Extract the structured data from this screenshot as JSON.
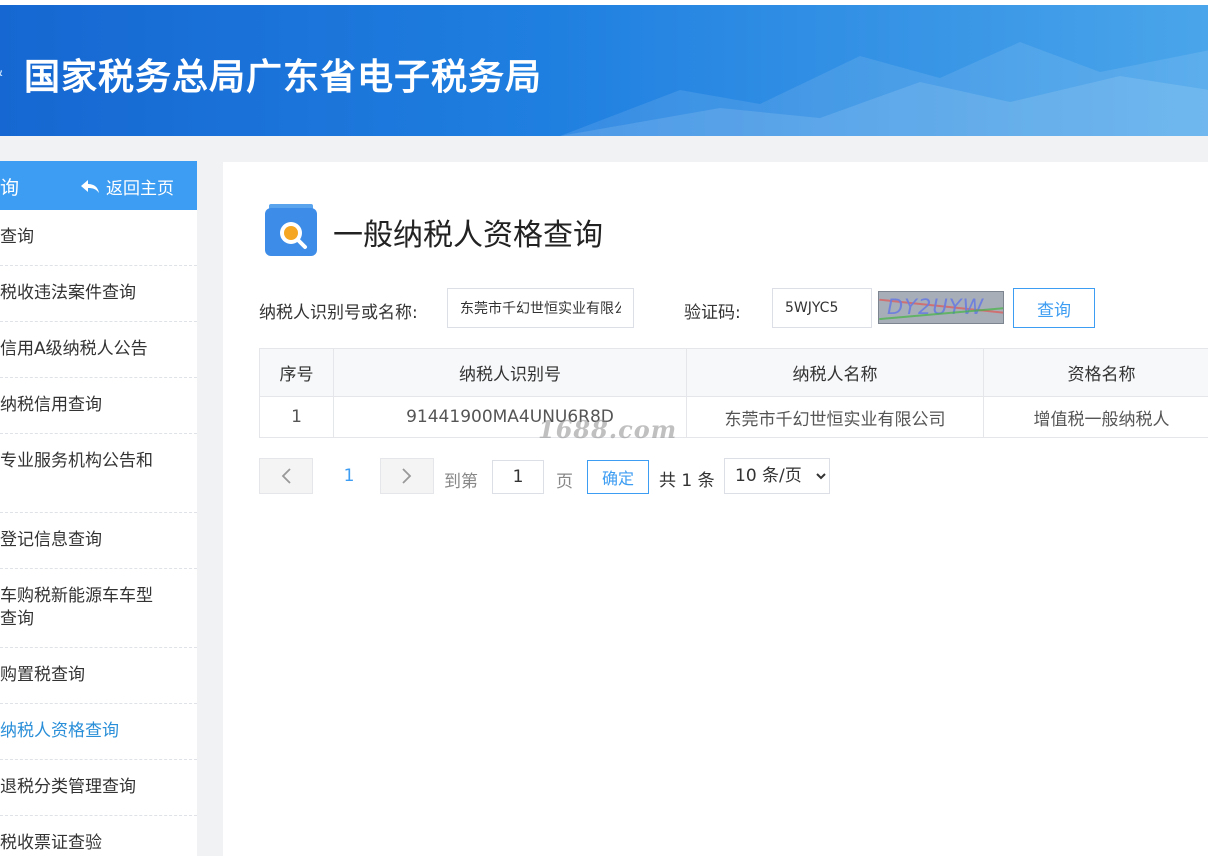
{
  "header": {
    "title": "国家税务总局广东省电子税务局",
    "logo_fragment": "&"
  },
  "sidebar": {
    "head_title": "询",
    "back_label": "返回主页",
    "items": [
      {
        "label": "查询"
      },
      {
        "label": "税收违法案件查询"
      },
      {
        "label": "信用A级纳税人公告"
      },
      {
        "label": "纳税信用查询"
      },
      {
        "label": "专业服务机构公告和"
      },
      {
        "label": "登记信息查询"
      },
      {
        "label": "车购税新能源车车型查询"
      },
      {
        "label": "购置税查询"
      },
      {
        "label": "纳税人资格查询"
      },
      {
        "label": "退税分类管理查询"
      },
      {
        "label": "税收票证查验"
      }
    ]
  },
  "page": {
    "title": "一般纳税人资格查询"
  },
  "form": {
    "taxpayer_label": "纳税人识别号或名称:",
    "taxpayer_value": "东莞市千幻世恒实业有限公",
    "captcha_label": "验证码:",
    "captcha_value": "5WJYC5",
    "captcha_image_text": "DY2UYW",
    "query_label": "查询"
  },
  "table": {
    "headers": [
      "序号",
      "纳税人识别号",
      "纳税人名称",
      "资格名称"
    ],
    "rows": [
      [
        "1",
        "91441900MA4UNU6R8D",
        "东莞市千幻世恒实业有限公司",
        "增值税一般纳税人"
      ]
    ]
  },
  "watermark": "1688.com",
  "pagination": {
    "current_page": "1",
    "goto_label": "到第",
    "goto_value": "1",
    "page_unit": "页",
    "confirm_label": "确定",
    "total_text": "共 1 条",
    "page_size": "10 条/页"
  },
  "colors": {
    "primary": "#3d9df2",
    "header_start": "#1667d1",
    "header_end": "#4aa5ea"
  }
}
